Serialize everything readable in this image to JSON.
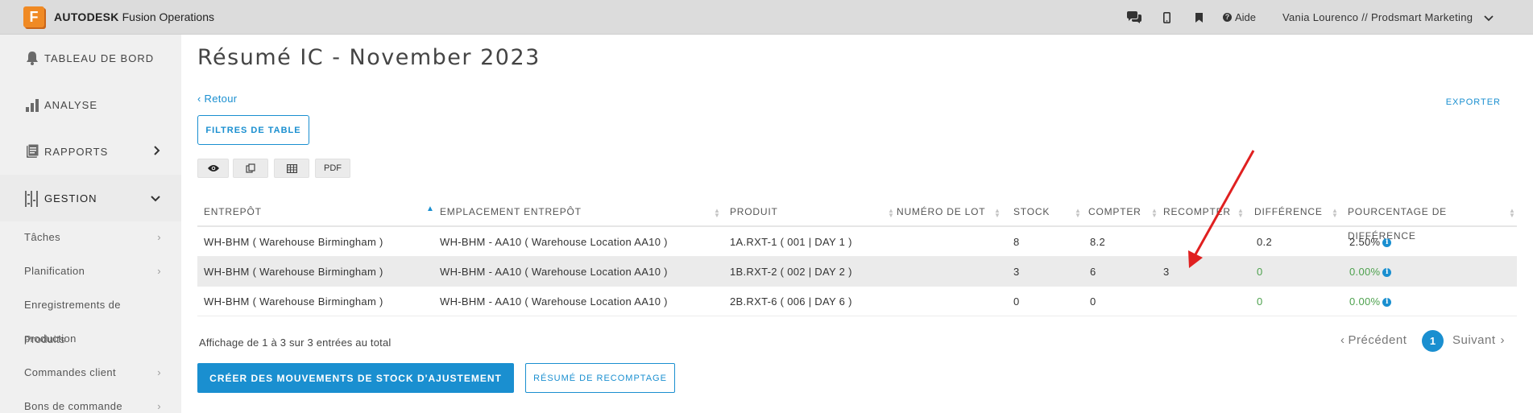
{
  "app": {
    "logo_letter": "F",
    "brand_bold": "AUTODESK",
    "brand_rest": "Fusion Operations",
    "help_label": "Aide",
    "user_label": "Vania Lourenco // Prodsmart Marketing"
  },
  "sidebar": {
    "main": [
      {
        "label": "TABLEAU DE BORD",
        "icon": "bell-icon"
      },
      {
        "label": "ANALYSE",
        "icon": "bar-chart-icon"
      },
      {
        "label": "RAPPORTS",
        "icon": "document-icon"
      },
      {
        "label": "GESTION",
        "icon": "list-icon"
      }
    ],
    "sub": [
      {
        "label": "Tâches"
      },
      {
        "label": "Planification"
      },
      {
        "label": "Enregistrements de"
      },
      {
        "label": "production"
      },
      {
        "label": "Commandes client"
      },
      {
        "label": "Bons de commande"
      }
    ],
    "overlap_text": "Produits"
  },
  "page": {
    "title": "Résumé IC - November 2023",
    "back": "Retour",
    "export": "EXPORTER",
    "filters": "FILTRES DE TABLE",
    "tools": [
      "eye-icon",
      "copy-icon",
      "table-icon",
      "PDF"
    ],
    "pdf_label": "PDF"
  },
  "table": {
    "headers": [
      "ENTREPÔT",
      "EMPLACEMENT ENTREPÔT",
      "PRODUIT",
      "NUMÉRO DE LOT",
      "STOCK",
      "COMPTER",
      "RECOMPTER",
      "DIFFÉRENCE",
      "POURCENTAGE DE DIFFÉRENCE"
    ],
    "sorted_column": "ENTREPÔT",
    "rows": [
      {
        "entrepot": "WH-BHM ( Warehouse Birmingham )",
        "emplacement": "WH-BHM - AA10 ( Warehouse Location AA10 )",
        "produit": "1A.RXT-1 ( 001 | DAY 1 )",
        "lot": "",
        "stock": "8",
        "compter": "8.2",
        "recompter": "",
        "difference": "0.2",
        "pourcentage": "2.50%"
      },
      {
        "entrepot": "WH-BHM ( Warehouse Birmingham )",
        "emplacement": "WH-BHM - AA10 ( Warehouse Location AA10 )",
        "produit": "1B.RXT-2 ( 002 | DAY 2 )",
        "lot": "",
        "stock": "3",
        "compter": "6",
        "recompter": "3",
        "difference": "0",
        "pourcentage": "0.00%"
      },
      {
        "entrepot": "WH-BHM ( Warehouse Birmingham )",
        "emplacement": "WH-BHM - AA10 ( Warehouse Location AA10 )",
        "produit": "2B.RXT-6 ( 006 | DAY 6 )",
        "lot": "",
        "stock": "0",
        "compter": "0",
        "recompter": "",
        "difference": "0",
        "pourcentage": "0.00%"
      }
    ]
  },
  "footer": {
    "info": "Affichage de 1 à 3 sur 3 entrées au total",
    "prev": "Précédent",
    "next": "Suivant",
    "page": "1",
    "create_button": "CRÉER DES MOUVEMENTS DE STOCK D'AJUSTEMENT",
    "recount_button": "RÉSUMÉ DE RECOMPTAGE"
  },
  "colors": {
    "accent": "#1a8fd0",
    "positive_green": "#4ea14e",
    "annotation_arrow": "#e02020",
    "logo_orange": "#f08a24"
  }
}
